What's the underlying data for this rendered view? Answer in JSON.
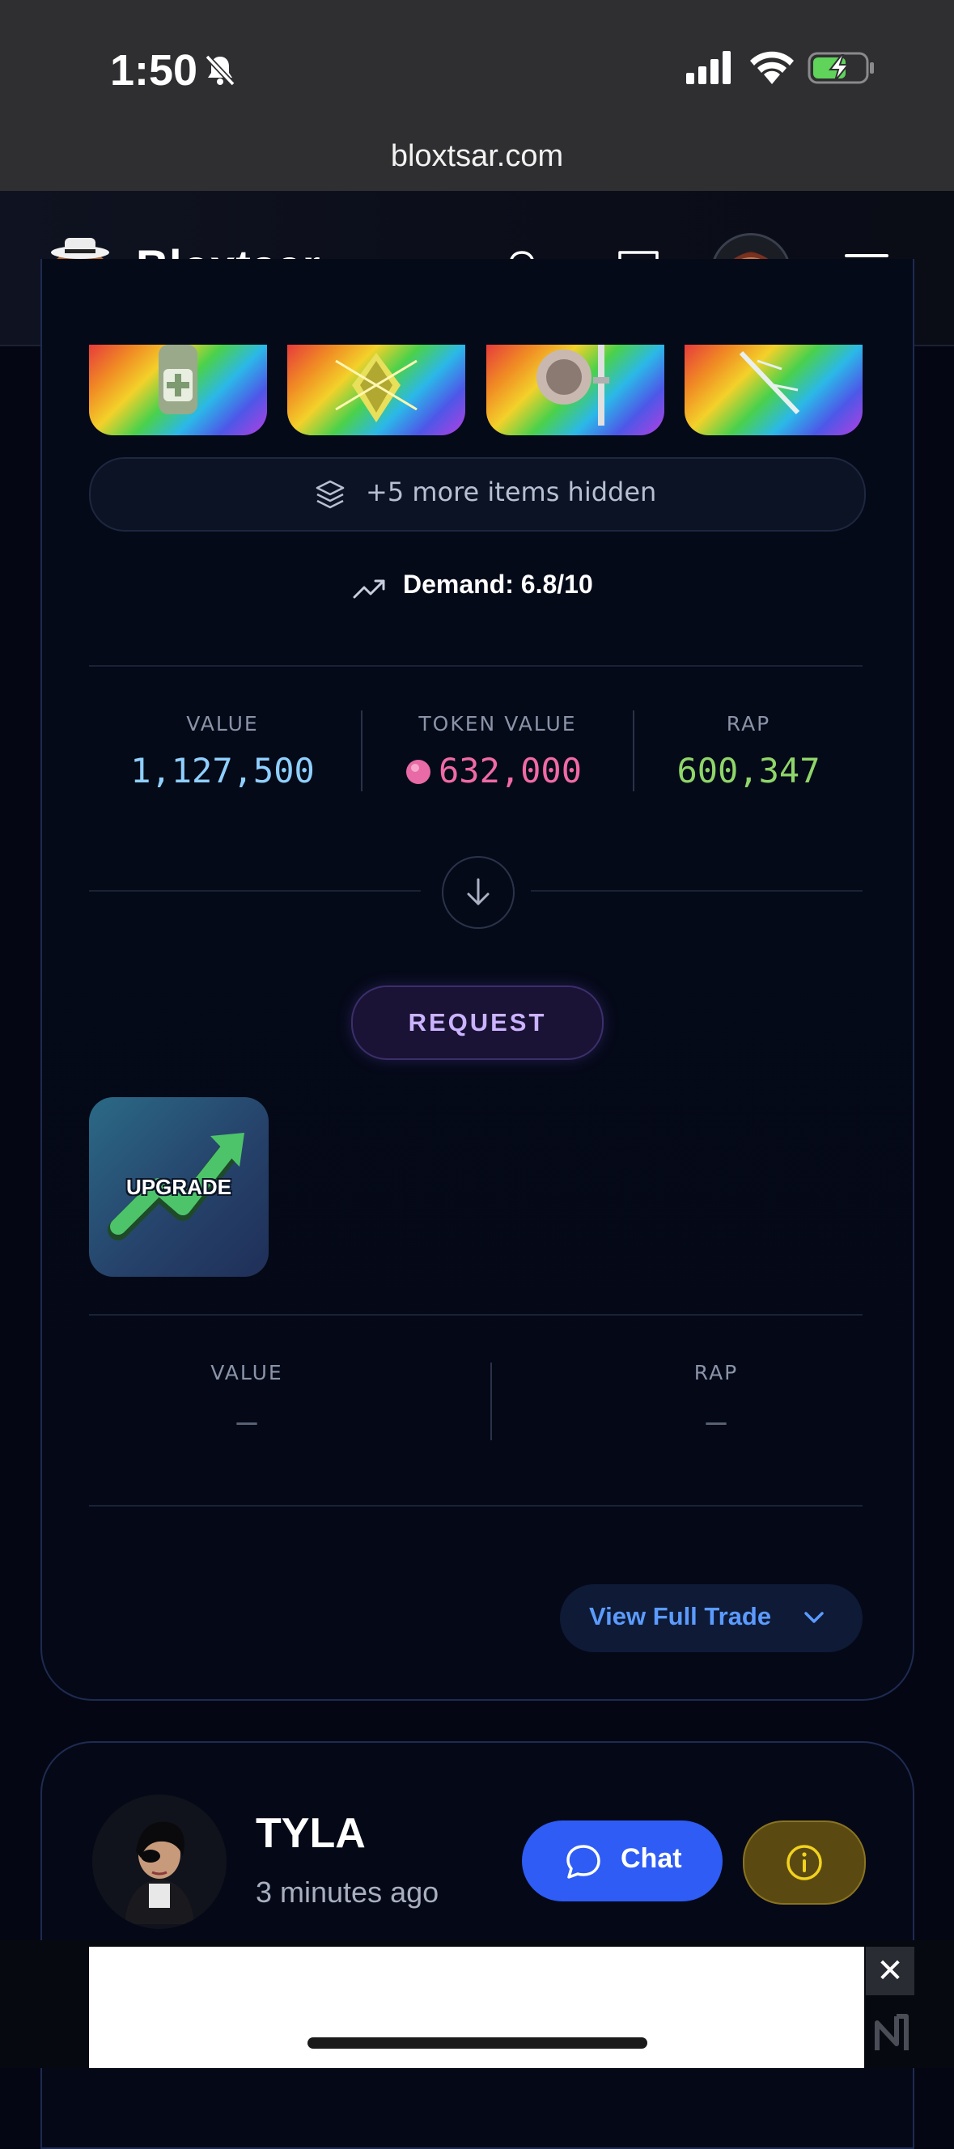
{
  "status_bar": {
    "time": "1:50",
    "url": "bloxtsar.com"
  },
  "header": {
    "brand": "Bloxtsar"
  },
  "trade_card": {
    "hidden_items_text": "+5 more items hidden",
    "demand_text": "Demand: 6.8/10",
    "offer_stats": {
      "value_label": "VALUE",
      "value": "1,127,500",
      "token_label": "TOKEN VALUE",
      "token_value": "632,000",
      "rap_label": "RAP",
      "rap": "600,347"
    },
    "request_label": "REQUEST",
    "request_item_label": "UPGRADE",
    "request_stats": {
      "value_label": "VALUE",
      "value": "–",
      "rap_label": "RAP",
      "rap": "–"
    },
    "view_full_trade_label": "View Full Trade"
  },
  "next_trade": {
    "username": "TYLA",
    "time_ago": "3 minutes ago",
    "chat_label": "Chat"
  },
  "ad": {
    "close_label": "✕"
  },
  "colors": {
    "value_blue": "#8fd0ff",
    "token_pink": "#f06aa6",
    "rap_green": "#8fd66a",
    "accent_blue": "#2e5cf5",
    "request_purple": "#cbb3ff"
  }
}
